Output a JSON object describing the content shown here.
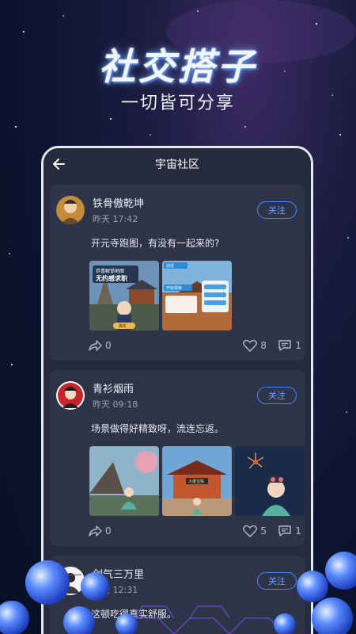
{
  "hero": {
    "title": "社交搭子",
    "subtitle": "一切皆可分享"
  },
  "screen": {
    "title": "宇宙社区"
  },
  "posts": [
    {
      "user": "铁骨傲乾坤",
      "time": "昨天 17:42",
      "follow": "关注",
      "text": "开元寺跑图，有没有一起来的?",
      "images": [
        {
          "label_top": "恭喜解锁地图",
          "label_big": "无约感求职",
          "button": "确定"
        },
        {
          "label_top": "创活",
          "label_big": "开始探索"
        }
      ],
      "shares": "0",
      "likes": "8",
      "comments": "1"
    },
    {
      "user": "青衫烟雨",
      "time": "昨天 09:18",
      "follow": "关注",
      "text": "场景做得好精致呀，流连忘返。",
      "images": [
        {
          "label_top": ""
        },
        {
          "label_top": "大雄宝殿"
        },
        {
          "label_top": ""
        }
      ],
      "shares": "0",
      "likes": "5",
      "comments": "1"
    },
    {
      "user": "剑气三万里",
      "time": "昨天 12:31",
      "follow": "关注",
      "text": "这顿吃得真实舒服。"
    }
  ],
  "colors": {
    "accent": "#4a82ff",
    "card": "#2e3448",
    "panel": "#252a3c"
  },
  "icons": [
    "back-arrow-icon",
    "share-icon",
    "heart-icon",
    "comment-icon"
  ]
}
